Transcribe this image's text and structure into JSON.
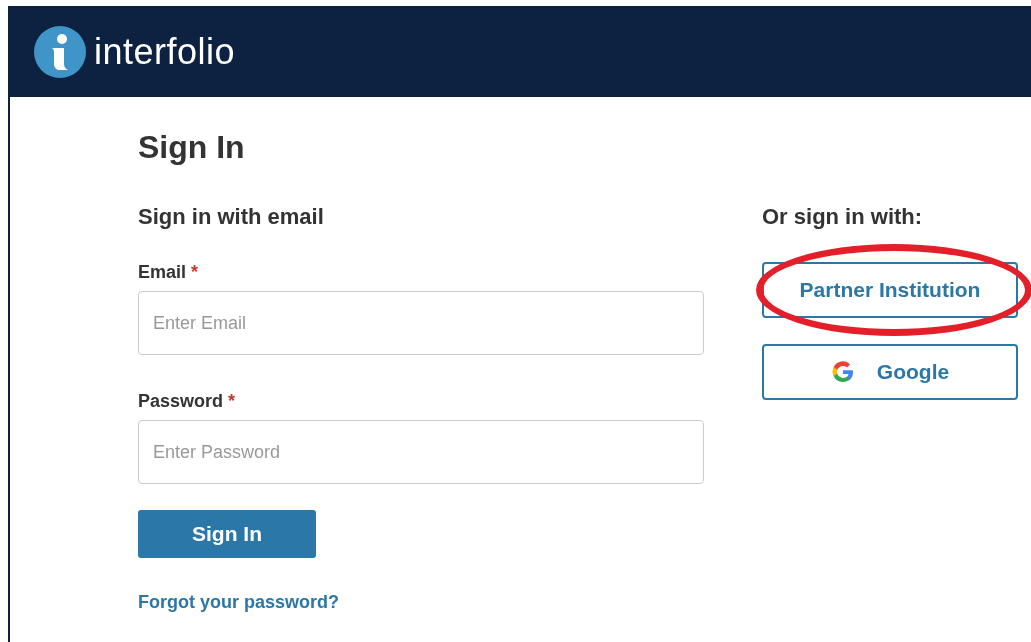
{
  "header": {
    "brand": "interfolio"
  },
  "title": "Sign In",
  "email_section": {
    "heading": "Sign in with email",
    "fields": [
      {
        "label": "Email",
        "required_mark": "*",
        "placeholder": "Enter Email"
      },
      {
        "label": "Password",
        "required_mark": "*",
        "placeholder": "Enter Password"
      }
    ],
    "submit": "Sign In",
    "forgot_link": "Forgot your password?"
  },
  "alt_section": {
    "heading": "Or sign in with:",
    "buttons": [
      {
        "label": "Partner Institution",
        "kind": "plain",
        "highlighted": true
      },
      {
        "label": "Google",
        "kind": "google",
        "highlighted": false
      }
    ]
  }
}
